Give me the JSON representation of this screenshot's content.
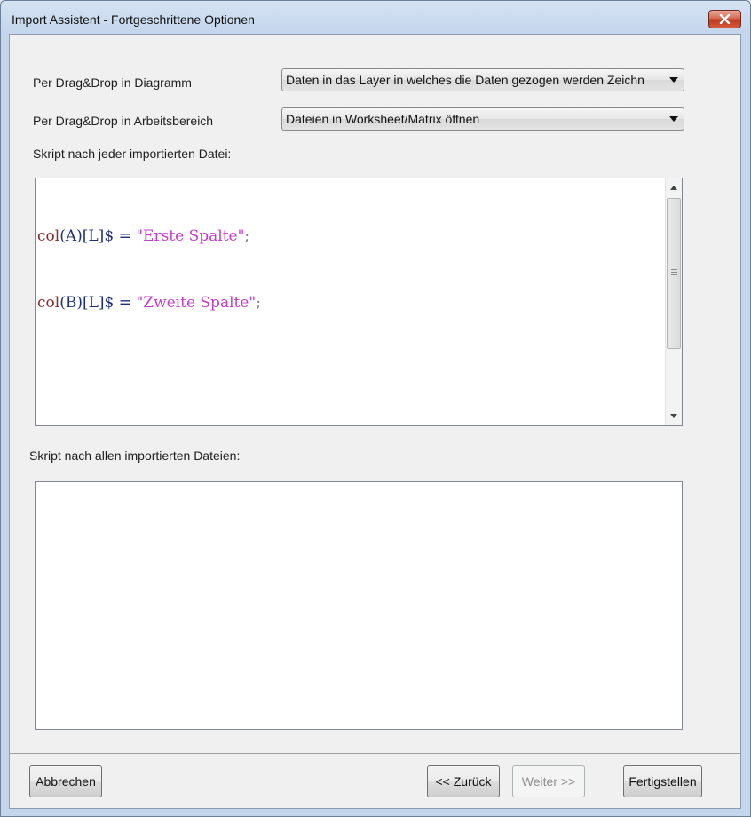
{
  "window": {
    "title": "Import Assistent - Fortgeschrittene Optionen",
    "close_icon": "close-icon"
  },
  "options": {
    "drag_drop_diagram_label": "Per Drag&Drop in Diagramm",
    "drag_drop_diagram_value": "Daten in das Layer in welches die Daten gezogen werden Zeichn",
    "drag_drop_workspace_label": "Per Drag&Drop in Arbeitsbereich",
    "drag_drop_workspace_value": "Dateien in Worksheet/Matrix öffnen"
  },
  "script_each": {
    "label": "Skript nach jeder importierten Datei:",
    "lines": [
      {
        "fn": "col",
        "paren_open": "(",
        "col": "A",
        "paren_close": ")",
        "bracket": "[L]",
        "dollar": "$",
        "eq": "=",
        "str": "\"Erste Spalte\"",
        "semi": ";"
      },
      {
        "fn": "col",
        "paren_open": "(",
        "col": "B",
        "paren_close": ")",
        "bracket": "[L]",
        "dollar": "$",
        "eq": "=",
        "str": "\"Zweite Spalte\"",
        "semi": ";"
      }
    ]
  },
  "script_all": {
    "label": "Skript nach allen importierten Dateien:",
    "content": ""
  },
  "buttons": {
    "cancel": "Abbrechen",
    "back": "<< Zurück",
    "next": "Weiter >>",
    "finish": "Fertigstellen"
  },
  "colors": {
    "keyword": "#8b2d2d",
    "string": "#c23dc8",
    "operator": "#1d2f7a"
  }
}
